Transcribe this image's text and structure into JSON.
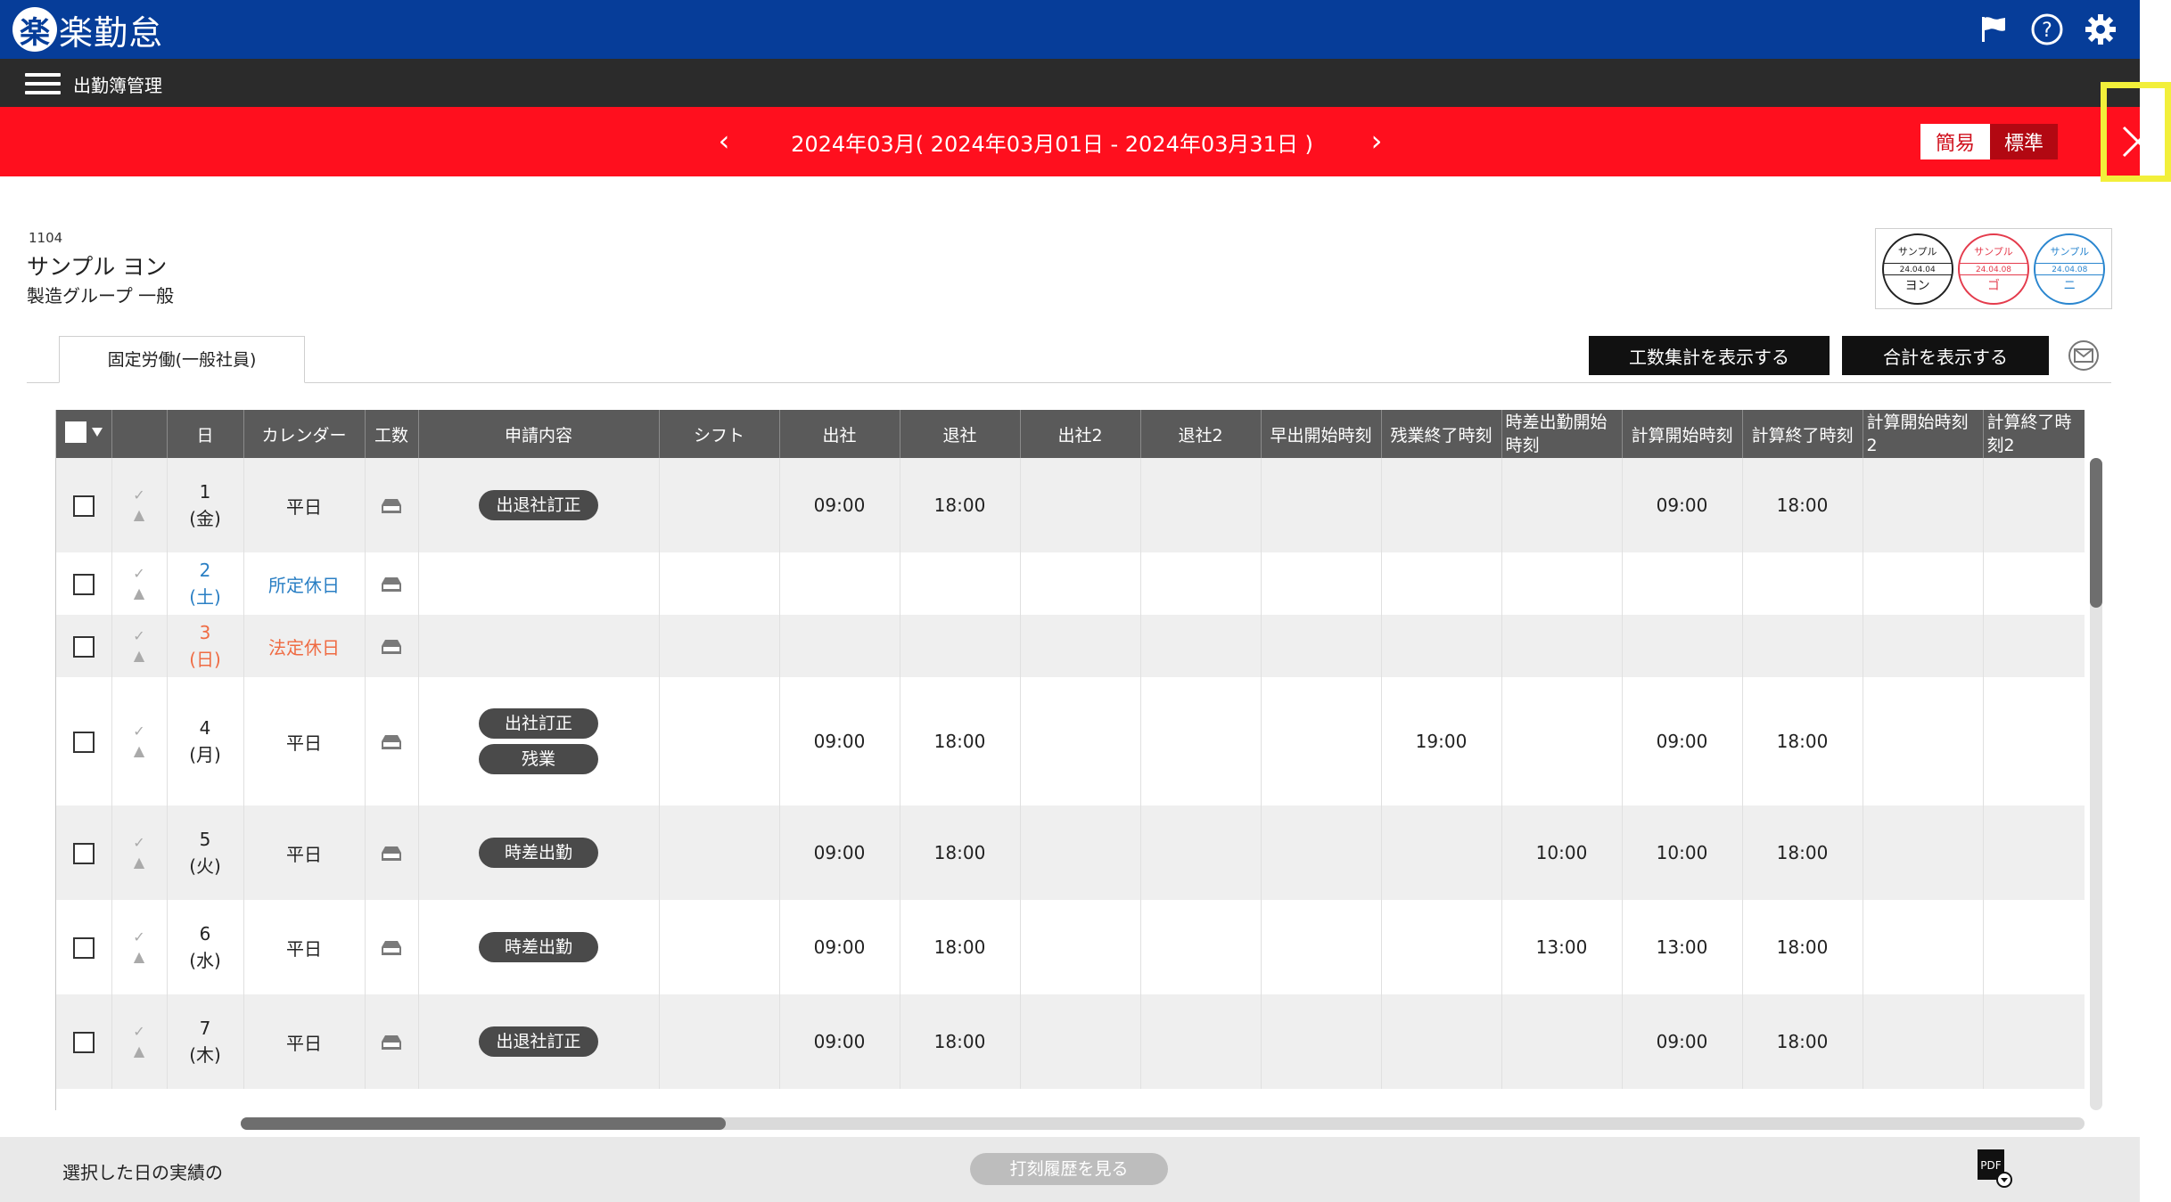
{
  "app": {
    "logo_mark": "楽",
    "logo_text": "楽勤怠"
  },
  "subbar": {
    "title": "出勤簿管理"
  },
  "period": {
    "prev": "‹",
    "next": "›",
    "label": "2024年03月( 2024年03月01日 - 2024年03月31日 )"
  },
  "mode": {
    "simple": "簡易",
    "standard": "標準"
  },
  "employee": {
    "id": "1104",
    "name": "サンプル ヨン",
    "group": "製造グループ 一般"
  },
  "stamps": [
    {
      "top": "サンプル",
      "date": "24.04.04",
      "bottom": "ヨン",
      "color": "#222222"
    },
    {
      "top": "サンプル",
      "date": "24.04.08",
      "bottom": "ゴ",
      "color": "#e43b4c"
    },
    {
      "top": "サンプル",
      "date": "24.04.08",
      "bottom": "ニ",
      "color": "#2a86cf"
    }
  ],
  "tab": {
    "label": "固定労働(一般社員)"
  },
  "buttons": {
    "koshu": "工数集計を表示する",
    "total": "合計を表示する"
  },
  "table": {
    "headers": [
      "日",
      "カレンダー",
      "工数",
      "申請内容",
      "シフト",
      "出社",
      "退社",
      "出社2",
      "退社2",
      "早出開始時刻",
      "残業終了時刻",
      "時差出勤開始時刻",
      "計算開始時刻",
      "計算終了時刻",
      "計算開始時刻2",
      "計算終了時刻2"
    ],
    "rows": [
      {
        "day": "1",
        "dow": "(金)",
        "calendar": "平日",
        "cal_type": "weekday",
        "requests": [
          "出退社訂正"
        ],
        "in": "09:00",
        "out": "18:00",
        "overtime_end": "",
        "stagger_start": "",
        "calc_start": "09:00",
        "calc_end": "18:00"
      },
      {
        "day": "2",
        "dow": "(土)",
        "calendar": "所定休日",
        "cal_type": "holiday-fixed",
        "requests": [],
        "in": "",
        "out": "",
        "overtime_end": "",
        "stagger_start": "",
        "calc_start": "",
        "calc_end": ""
      },
      {
        "day": "3",
        "dow": "(日)",
        "calendar": "法定休日",
        "cal_type": "holiday-legal",
        "requests": [],
        "in": "",
        "out": "",
        "overtime_end": "",
        "stagger_start": "",
        "calc_start": "",
        "calc_end": ""
      },
      {
        "day": "4",
        "dow": "(月)",
        "calendar": "平日",
        "cal_type": "weekday",
        "requests": [
          "出社訂正",
          "残業"
        ],
        "in": "09:00",
        "out": "18:00",
        "overtime_end": "19:00",
        "stagger_start": "",
        "calc_start": "09:00",
        "calc_end": "18:00"
      },
      {
        "day": "5",
        "dow": "(火)",
        "calendar": "平日",
        "cal_type": "weekday",
        "requests": [
          "時差出勤"
        ],
        "in": "09:00",
        "out": "18:00",
        "overtime_end": "",
        "stagger_start": "10:00",
        "calc_start": "10:00",
        "calc_end": "18:00"
      },
      {
        "day": "6",
        "dow": "(水)",
        "calendar": "平日",
        "cal_type": "weekday",
        "requests": [
          "時差出勤"
        ],
        "in": "09:00",
        "out": "18:00",
        "overtime_end": "",
        "stagger_start": "13:00",
        "calc_start": "13:00",
        "calc_end": "18:00"
      },
      {
        "day": "7",
        "dow": "(木)",
        "calendar": "平日",
        "cal_type": "weekday",
        "requests": [
          "出退社訂正"
        ],
        "in": "09:00",
        "out": "18:00",
        "overtime_end": "",
        "stagger_start": "",
        "calc_start": "09:00",
        "calc_end": "18:00"
      }
    ]
  },
  "footer": {
    "text": "選択した日の実績の",
    "history_button": "打刻履歴を見る",
    "pdf_label": "PDF"
  },
  "colors": {
    "topbar": "#063d99",
    "periodbar": "#ff0f1e",
    "highlight": "#f2ef3a",
    "holiday_fixed": "#2a7fc4",
    "holiday_legal": "#ef6b43"
  },
  "icons": [
    "flag-icon",
    "help-icon",
    "gear-icon",
    "hamburger-menu-icon",
    "close-icon",
    "tray-icon",
    "check-icon",
    "warning-icon",
    "mail-check-icon",
    "pdf-download-icon"
  ]
}
